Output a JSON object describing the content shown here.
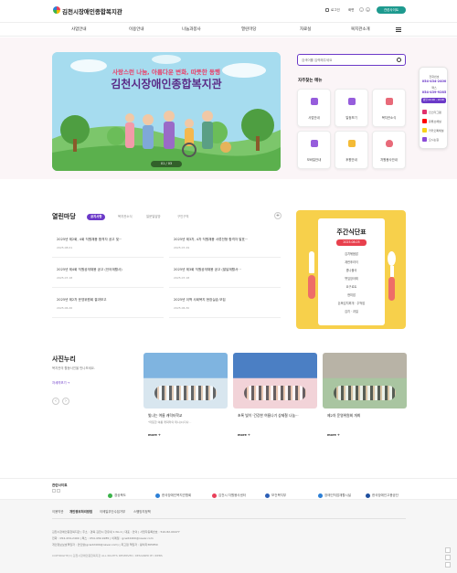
{
  "header": {
    "logo_text": "김천시장애인종합복지관",
    "util_login": "로그인",
    "util_font": "화면",
    "util_minus": "-",
    "util_plus": "+",
    "related_button": "관련사이트"
  },
  "nav": {
    "items": [
      "사업안내",
      "이용안내",
      "나눔과봉사",
      "열린마당",
      "자료실",
      "복지관소개"
    ],
    "menu_icon": "hamburger-icon"
  },
  "hero": {
    "tagline": "사랑스런 나눔, 아름다운 변화, 따뜻한 동행",
    "title": "김천시장애인종합복지관",
    "pager": "01 / 03"
  },
  "search": {
    "placeholder": "검색어를 입력해주세요"
  },
  "quick_menu": {
    "heading": "자주찾는 메뉴",
    "items": [
      {
        "label": "사업안내",
        "icon": "tablet-icon",
        "color": "#8b4bd8"
      },
      {
        "label": "일정보기",
        "icon": "calendar-icon",
        "color": "#8b4bd8"
      },
      {
        "label": "복지관소식",
        "icon": "news-icon",
        "color": "#e55a6a"
      },
      {
        "label": "모바일안내",
        "icon": "mobile-icon",
        "color": "#8b4bd8"
      },
      {
        "label": "후원안내",
        "icon": "light-bulb-icon",
        "color": "#f3b420"
      },
      {
        "label": "자원봉사안내",
        "icon": "heart-icon",
        "color": "#e55a6a"
      }
    ]
  },
  "side_widget": {
    "label1": "전화번호",
    "phone": "054-434-2400",
    "label2": "팩스",
    "fax": "054-439-9285",
    "hours": "평일 09:00 - 18:00",
    "links": [
      {
        "label": "인스타그램",
        "color": "#e1306c"
      },
      {
        "label": "유튜브채널",
        "color": "#ff0000"
      },
      {
        "label": "카카오톡채널",
        "color": "#f7d21a"
      },
      {
        "label": "오시는길",
        "color": "#8b4bd8"
      }
    ]
  },
  "board": {
    "title": "열린마당",
    "tabs": [
      "공지사항",
      "복지관소식",
      "일문일답방",
      "구인구직"
    ],
    "active_tab": 0,
    "plus": "+",
    "posts": [
      {
        "title": "2025년 제2회, 4회 직원채용 합격자 공고 및···",
        "date": "2025.08.01"
      },
      {
        "title": "2025년 제3차, 4차 직원채용 서류전형 합격자 발표···",
        "date": "2025.07.29"
      },
      {
        "title": "2025년 제4회 직원공개채용 공고 (언어재활사)",
        "date": "2025.07.18"
      },
      {
        "title": "2025년 제3회 직원공개채용 공고 (발달재활서···",
        "date": "2025.07.18"
      },
      {
        "title": "2025년 제2차 운영위원회 결과보고",
        "date": "2025.06.26"
      },
      {
        "title": "2025년 이백 사회복지 현장실습 모집",
        "date": "2025.06.30"
      }
    ]
  },
  "menu_card": {
    "title": "주간식단표",
    "date": "2025.08.05",
    "items": [
      "김치볶음밥",
      "계란후라이",
      "콩나물국",
      "깻잎장아찌",
      "요구르트",
      "현미밥",
      "돈육김치찌개 · 주먹밥",
      "김치 · 과일"
    ],
    "bg": "#f7d04b"
  },
  "gallery": {
    "title": "사진누리",
    "subtitle": "복지관의 활동사진을 만나보세요.",
    "more_link": "자세히보기 →",
    "prev": "‹",
    "next": "›",
    "items": [
      {
        "title": "빛나는 여름 캐릭터학교",
        "desc": "\"따뜻한 여름 캐릭터의 테니(C)다나···",
        "more": "more +"
      },
      {
        "title": "초록 빛이 '건강한 여름나기 상제철 나눔···",
        "desc": "",
        "more": "more +"
      },
      {
        "title": "제2차 운영위원회 개최",
        "desc": "",
        "more": "more +"
      }
    ]
  },
  "partners": {
    "label": "관련사이트",
    "logos": [
      "경상북도",
      "한국장애인복지관협회",
      "김천시 자원봉사센터",
      "보건복지부",
      "장애인직업재활시설",
      "한국장애인고용공단"
    ]
  },
  "footer": {
    "links": [
      "이용약관",
      "개인정보처리방침",
      "이메일무단수집거부",
      "스팸방지정책"
    ],
    "address_line": "김천시장애인종합복지관   |   주소 : 경북 김천시 한유새 1 No.1  |  대표 : 안의   |  사업자등록번호 : 510-82-09477",
    "contact_line": "전화 : 054-434-2400  |  팩스 : 054-439-9285  |  이메일 : gcwd2400@naver.com",
    "privacy_line": "개인정보보호책임자 : 안인팔(gcwd2400@naver.com)  |  최고점 책임자 : 황이지365850",
    "copyright": "COPYRIGHT(C) 김천시장애인종합복지관 ALL RIGHTS RESERVED. DESIGNED BY WEBS"
  }
}
